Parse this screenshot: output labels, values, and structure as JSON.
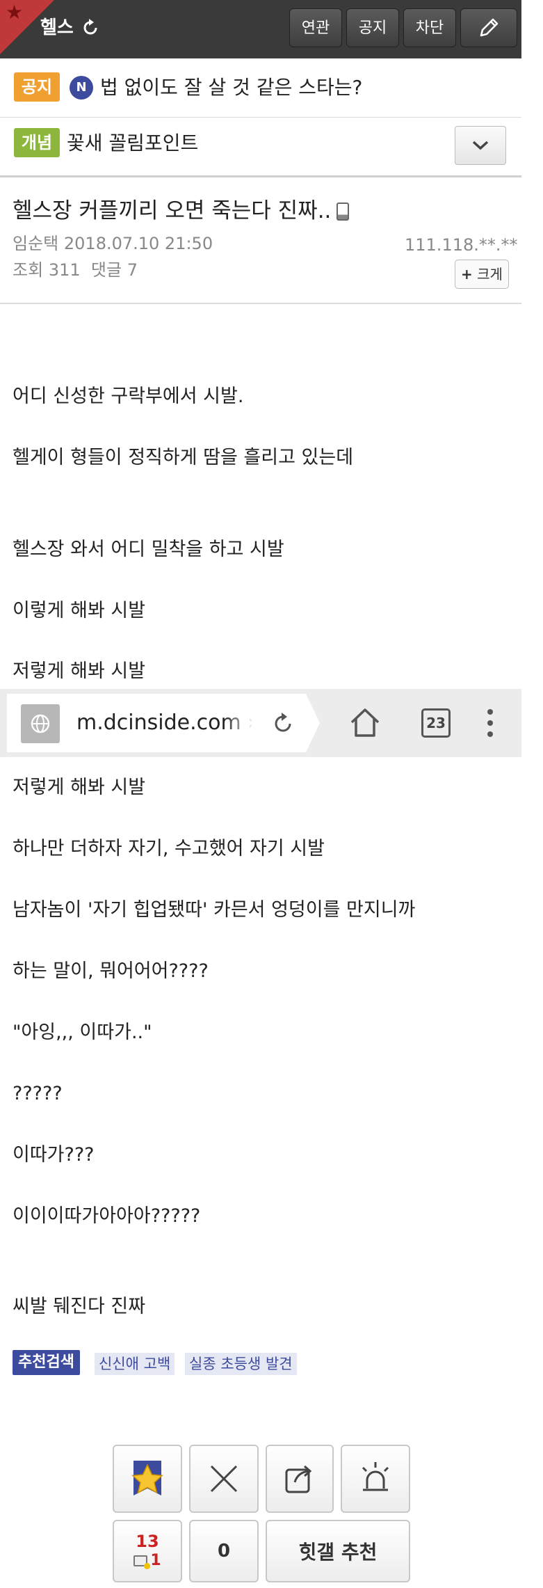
{
  "header": {
    "gallery_name": "헬스",
    "buttons": {
      "related": "연관",
      "notice": "공지",
      "block": "차단"
    },
    "colors": {
      "bar": "#3a3a3a",
      "corner": "#c0383a"
    }
  },
  "notice_rows": [
    {
      "badge": "공지",
      "badge_color": "#f0a030",
      "new_marker": "N",
      "text": "법 없이도 잘 살 것 같은 스타는?"
    },
    {
      "badge": "개념",
      "badge_color": "#8cb63c",
      "text": "꽃새 꼴림포인트"
    }
  ],
  "post": {
    "title": "헬스장 커플끼리 오면 죽는다 진짜..",
    "author": "임순택",
    "datetime": "2018.07.10 21:50",
    "ip": "111.118.**.**",
    "views_label": "조회",
    "views": "311",
    "comments_label": "댓글",
    "comments": "7",
    "enlarge_button": "크게"
  },
  "body_lines_top": [
    "어디 신성한 구락부에서 시발.",
    "헬게이 형들이 정직하게 땀을 흘리고 있는데",
    "헬스장 와서 어디 밀착을 하고 시발",
    "이렇게 해봐 시발",
    "저렇게 해봐 시발"
  ],
  "browser": {
    "url": "m.dcinside.com › 헬스",
    "tab_count": "23"
  },
  "body_lines_bottom": [
    "저렇게 해봐 시발",
    "하나만 더하자 자기, 수고했어 자기 시발",
    "남자놈이 '자기 힙업됐따' 카믄서 엉덩이를 만지니까",
    "하는 말이, 뭐어어어????",
    "\"아잉,,, 이따가..\"",
    "?????",
    "이따가???",
    "이이이따가아아아?????",
    "씨발 뒈진다 진짜"
  ],
  "tags": {
    "title": "추천검색",
    "items": [
      "신신애 고백",
      "실종 초등생 발견"
    ]
  },
  "actions": {
    "recommend_count": "13",
    "fixed_count": "1",
    "downvote_count": "0",
    "hit_gallery": "힛갤 추천"
  }
}
